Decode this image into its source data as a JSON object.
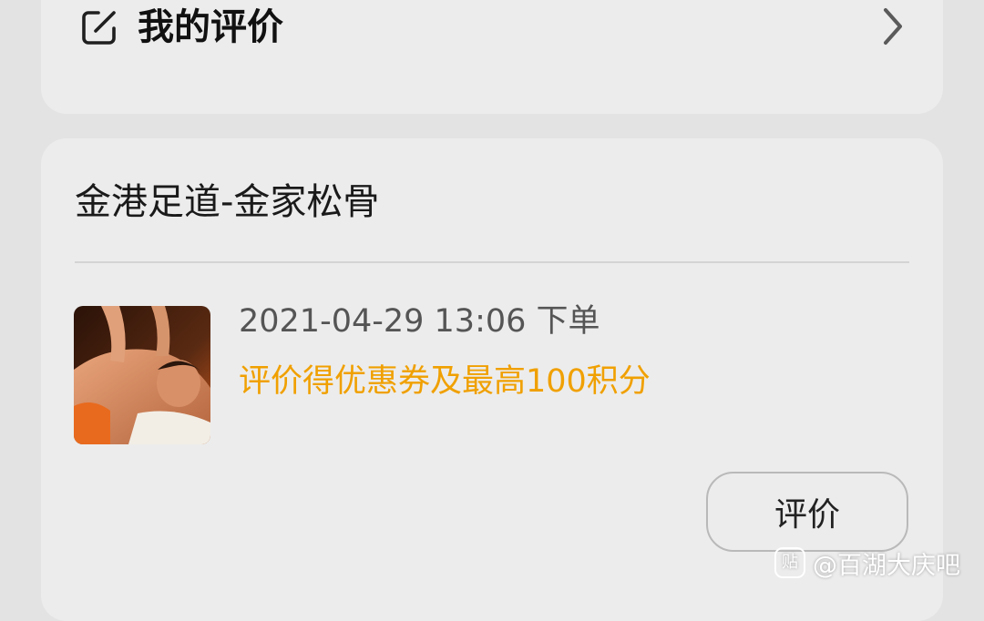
{
  "reviews_section": {
    "title": "我的评价",
    "icon": "edit-icon"
  },
  "order_card": {
    "shop_name": "金港足道-金家松骨",
    "order_time": "2021-04-29 13:06 下单",
    "promo_text": "评价得优惠券及最高100积分",
    "review_button_label": "评价"
  },
  "watermark": {
    "logo": "贴",
    "text": "@百湖大庆吧"
  },
  "colors": {
    "page_background": "#e3e3e3",
    "card_background": "#ececec",
    "promo_accent": "#f0a000"
  }
}
